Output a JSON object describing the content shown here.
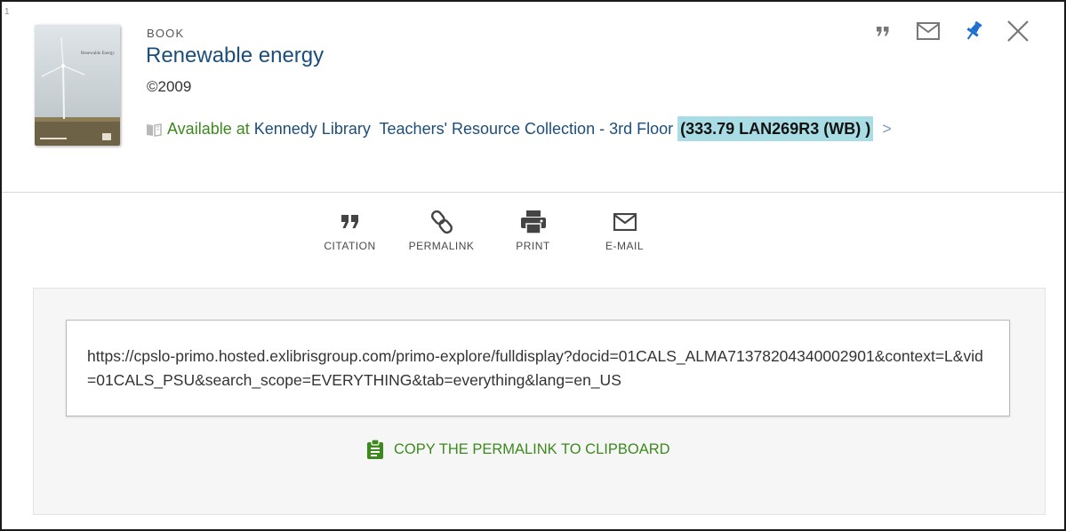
{
  "result": {
    "index": "1",
    "type": "BOOK",
    "title": "Renewable energy",
    "date": "©2009",
    "availability": {
      "status": "Available at",
      "library": "Kennedy Library",
      "location": "Teachers' Resource Collection - 3rd Floor",
      "call_number": "(333.79 LAN269R3 (WB) )"
    },
    "cover": {
      "title_text": "Renewable Energy"
    }
  },
  "top_actions": [
    {
      "name": "quote-icon"
    },
    {
      "name": "envelope-icon"
    },
    {
      "name": "pin-icon"
    },
    {
      "name": "close-icon"
    }
  ],
  "send_actions": {
    "citation": "CITATION",
    "permalink": "PERMALINK",
    "print": "PRINT",
    "email": "E-MAIL"
  },
  "permalink_panel": {
    "url": "https://cpslo-primo.hosted.exlibrisgroup.com/primo-explore/fulldisplay?docid=01CALS_ALMA71378204340002901&context=L&vid=01CALS_PSU&search_scope=EVERYTHING&tab=everything&lang=en_US",
    "copy_label": "COPY THE PERMALINK TO CLIPBOARD"
  },
  "colors": {
    "link_blue": "#1c4e7c",
    "available_green": "#3c8a1d",
    "highlight": "#a9dde5",
    "pin_blue": "#1c6fd1"
  }
}
